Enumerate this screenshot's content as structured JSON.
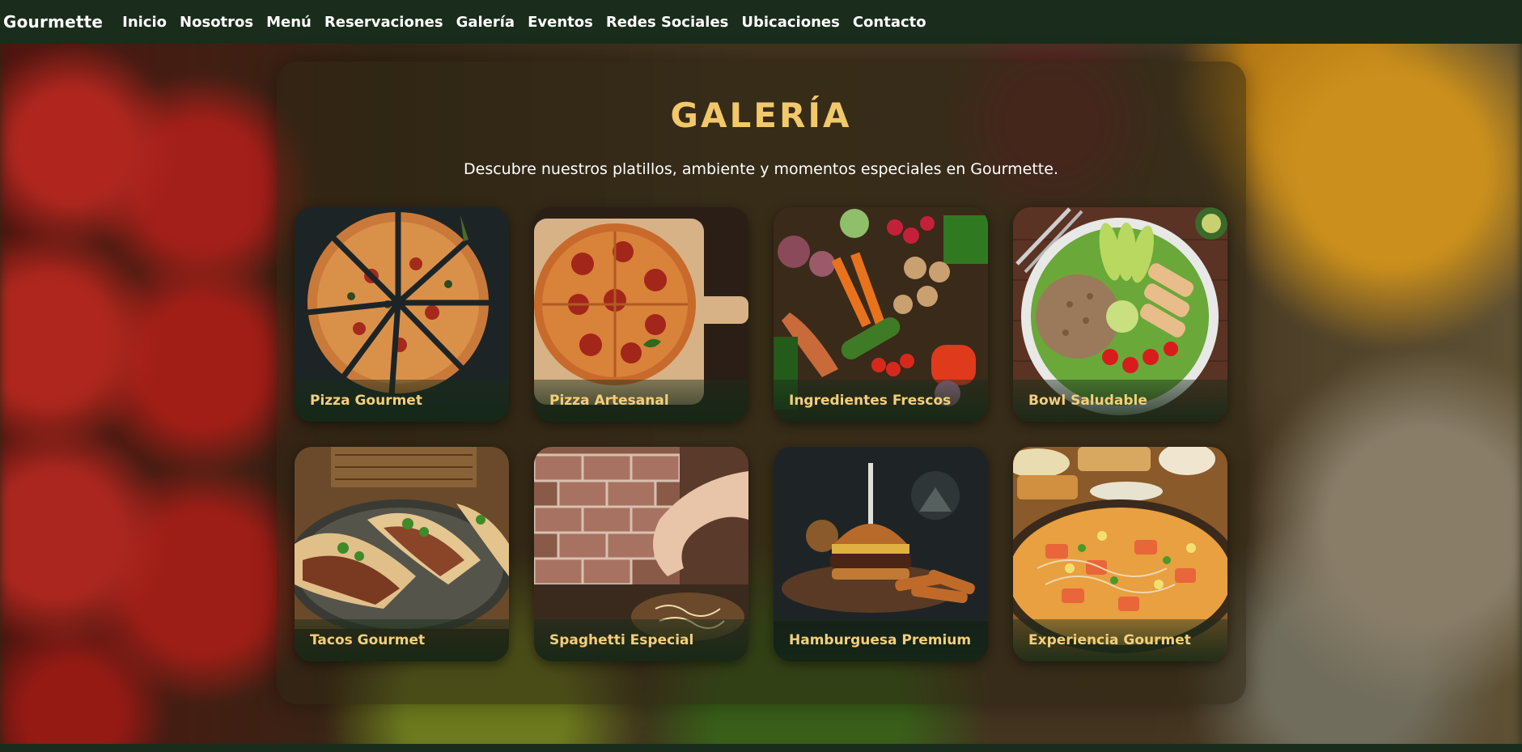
{
  "nav": {
    "brand": "Gourmette",
    "links": [
      "Inicio",
      "Nosotros",
      "Menú",
      "Reservaciones",
      "Galería",
      "Eventos",
      "Redes Sociales",
      "Ubicaciones",
      "Contacto"
    ]
  },
  "gallery": {
    "title": "GALERÍA",
    "subtitle": "Descubre nuestros platillos, ambiente y momentos especiales en Gourmette.",
    "items": [
      {
        "caption": "Pizza Gourmet"
      },
      {
        "caption": "Pizza Artesanal"
      },
      {
        "caption": "Ingredientes Frescos"
      },
      {
        "caption": "Bowl Saludable"
      },
      {
        "caption": "Tacos Gourmet"
      },
      {
        "caption": "Spaghetti Especial"
      },
      {
        "caption": "Hamburguesa Premium"
      },
      {
        "caption": "Experiencia Gourmet"
      }
    ]
  },
  "colors": {
    "navbar": "#1a2c1b",
    "title": "#f2c86a",
    "caption": "#f3cf7a"
  }
}
